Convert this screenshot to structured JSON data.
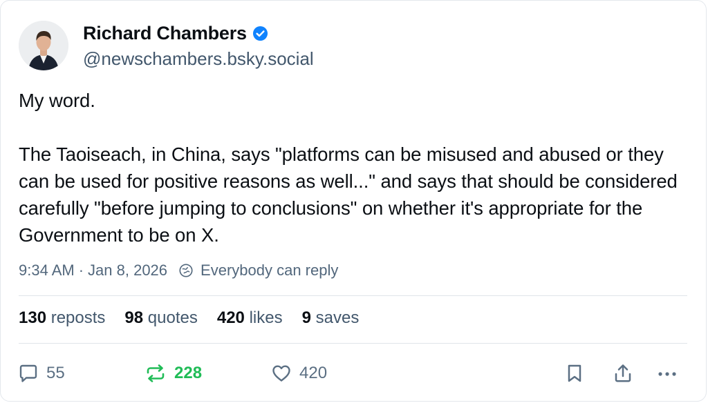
{
  "author": {
    "display_name": "Richard Chambers",
    "handle": "@newschambers.bsky.social",
    "verified": true
  },
  "post": {
    "text": "My word.\n\nThe Taoiseach, in China, says \"platforms can be misused and abused or they can be used for positive reasons as well...\" and says that should be considered carefully \"before jumping to conclusions\" on whether it's appropriate for the Government to be on X.",
    "time": "9:34 AM",
    "separator": "·",
    "date": "Jan 8, 2026",
    "reply_setting": "Everybody can reply"
  },
  "stats": {
    "reposts_count": "130",
    "reposts_label": "reposts",
    "quotes_count": "98",
    "quotes_label": "quotes",
    "likes_count": "420",
    "likes_label": "likes",
    "saves_count": "9",
    "saves_label": "saves"
  },
  "actions": {
    "reply_count": "55",
    "repost_count": "228",
    "like_count": "420"
  },
  "icons": {
    "verified": "verified-badge-icon",
    "reply_setting": "globe-icon",
    "reply": "speech-bubble-icon",
    "repost": "repost-arrows-icon",
    "like": "heart-icon",
    "bookmark": "bookmark-icon",
    "share": "share-icon",
    "more": "more-dots-icon"
  },
  "colors": {
    "verified_blue": "#1083fe",
    "repost_green": "#20bc57",
    "muted_text": "#42576c"
  }
}
